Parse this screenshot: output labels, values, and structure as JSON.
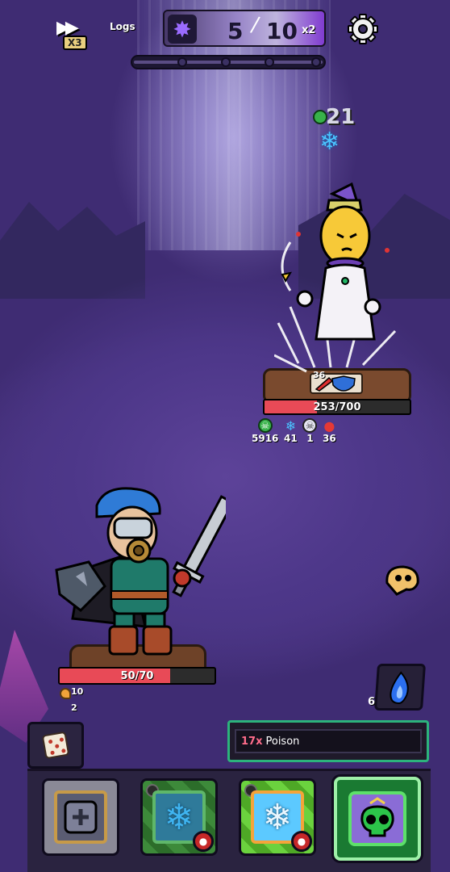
{
  "hud": {
    "speed": {
      "label": "X3",
      "icon": "fast-forward-icon"
    },
    "logs_label": "Logs",
    "energy": {
      "current": "5",
      "max": "10",
      "multiplier": "x2",
      "icon": "energy-star-icon"
    },
    "settings_icon": "gear-icon",
    "turn_track": {
      "nodes": 4
    }
  },
  "enemy": {
    "top_buff": {
      "value": "21",
      "icons": [
        "poison-skull-icon",
        "freeze-snowflake-icon"
      ]
    },
    "intent_value": "36",
    "hp": {
      "current": 253,
      "max": 700,
      "text": "253/700"
    },
    "statuses": [
      {
        "name": "poison",
        "icon": "green-skull-icon",
        "value": "5916",
        "color": "#38b24a"
      },
      {
        "name": "freeze",
        "icon": "snowflake-icon",
        "value": "41",
        "color": "#4ac3ff"
      },
      {
        "name": "weak",
        "icon": "cracked-skull-icon",
        "value": "1",
        "color": "#e6e6f2"
      },
      {
        "name": "bleed",
        "icon": "blood-drop-icon",
        "value": "36",
        "color": "#e53935"
      }
    ]
  },
  "hero": {
    "hp": {
      "current": 50,
      "max": 70,
      "text": "50/70"
    },
    "block": {
      "icon": "shield-icon",
      "value": "10",
      "sub_value": "2"
    }
  },
  "flame": {
    "count": "6",
    "icon": "blue-flame-icon"
  },
  "tooltip": {
    "count": "17x",
    "name": "Poison"
  },
  "hand": {
    "dice_icon": "dice-icon",
    "cards": [
      {
        "name": "dice-plus-card",
        "icon": "dice-plus-icon"
      },
      {
        "name": "freeze-card-dark",
        "icon": "snowflake-icon",
        "badges": [
          "skull-badge-icon",
          "blood-drop-icon"
        ]
      },
      {
        "name": "freeze-card-bright",
        "icon": "snowflake-icon",
        "badges": [
          "skull-badge-icon",
          "blood-drop-icon"
        ]
      },
      {
        "name": "poison-card-selected",
        "icon": "poison-skull-icon"
      }
    ]
  }
}
